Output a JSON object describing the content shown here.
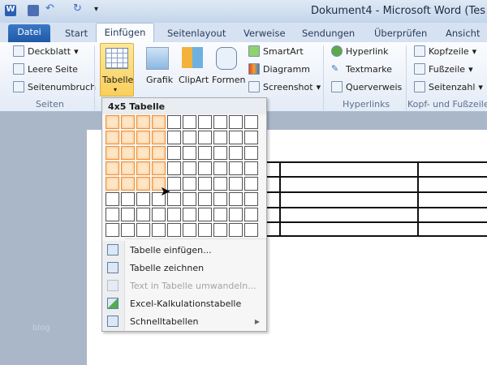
{
  "window": {
    "title": "Dokument4 - Microsoft Word (Tes"
  },
  "tabs": [
    "Datei",
    "Start",
    "Einfügen",
    "Seitenlayout",
    "Verweise",
    "Sendungen",
    "Überprüfen",
    "Ansicht"
  ],
  "ribbon": {
    "seiten": {
      "items": [
        "Deckblatt",
        "Leere Seite",
        "Seitenumbruch"
      ],
      "group": "Seiten"
    },
    "tabelle": "Tabelle",
    "illustrations": {
      "grafik": "Grafik",
      "clipart": "ClipArt",
      "formen": "Formen",
      "smartart": "SmartArt",
      "diagramm": "Diagramm",
      "screenshot": "Screenshot"
    },
    "hyperlinks": {
      "items": [
        "Hyperlink",
        "Textmarke",
        "Querverweis"
      ],
      "group": "Hyperlinks"
    },
    "kopf": {
      "items": [
        "Kopfzeile",
        "Fußzeile",
        "Seitenzahl"
      ],
      "group": "Kopf- und Fußzeile"
    }
  },
  "menu": {
    "header": "4x5 Tabelle",
    "grid": {
      "cols": 10,
      "rows": 8,
      "selected_cols": 4,
      "selected_rows": 5
    },
    "items": [
      {
        "label": "Tabelle einfügen...",
        "enabled": true
      },
      {
        "label": "Tabelle zeichnen",
        "enabled": true
      },
      {
        "label": "Text in Tabelle umwandeln...",
        "enabled": false
      },
      {
        "label": "Excel-Kalkulationstabelle",
        "enabled": true
      },
      {
        "label": "Schnelltabellen",
        "enabled": true,
        "submenu": true
      }
    ]
  },
  "watermark": "blog"
}
